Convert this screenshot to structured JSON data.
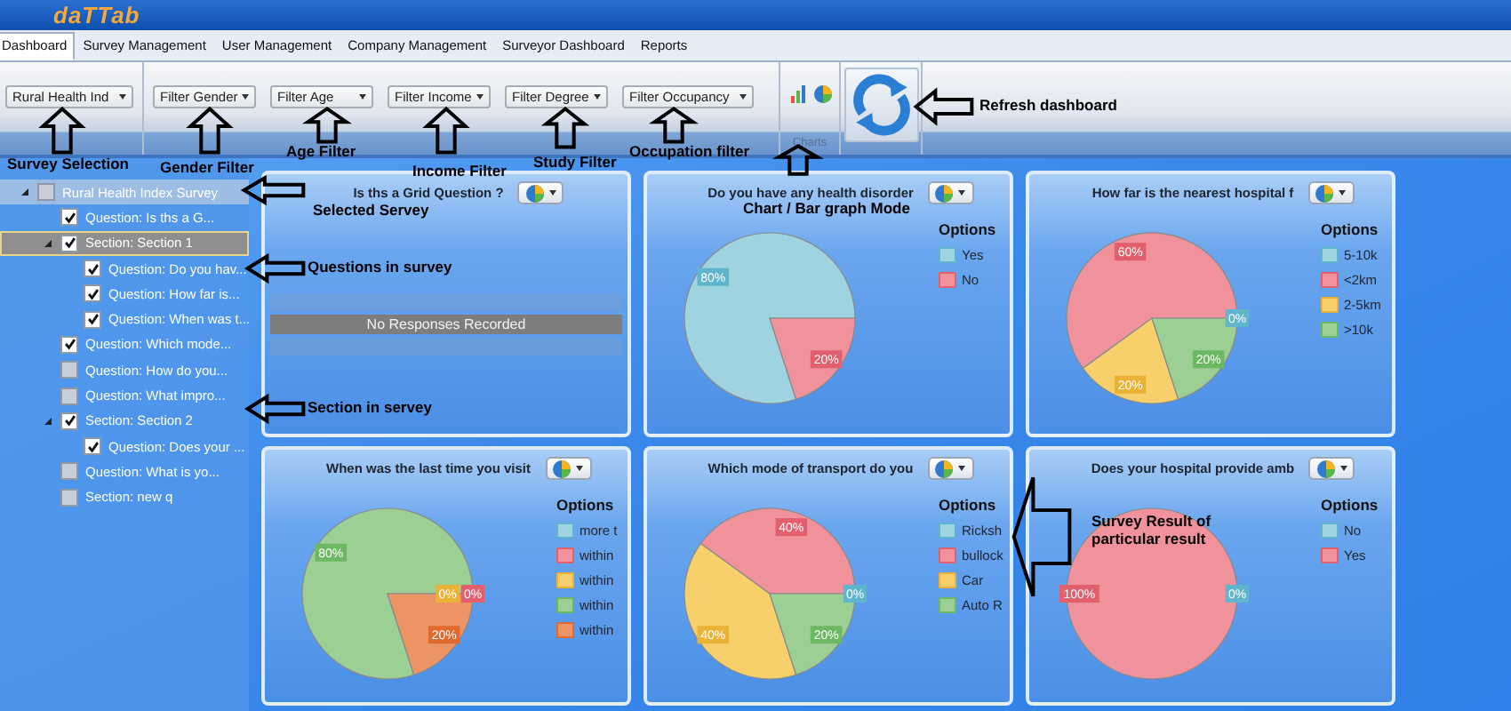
{
  "app": {
    "logo": "daTTab"
  },
  "menu": [
    {
      "label": "Dashboard",
      "selected": true
    },
    {
      "label": "Survey Management",
      "selected": false
    },
    {
      "label": "User Management",
      "selected": false
    },
    {
      "label": "Company Management",
      "selected": false
    },
    {
      "label": "Surveyor Dashboard",
      "selected": false
    },
    {
      "label": "Reports",
      "selected": false
    }
  ],
  "ribbon": {
    "survey_selector": {
      "value": "Rural Health Ind"
    },
    "filters": [
      {
        "value": "Filter Gender"
      },
      {
        "value": "Filter Age"
      },
      {
        "value": "Filter Income"
      },
      {
        "value": "Filter Degree"
      },
      {
        "value": "Filter Occupancy"
      }
    ],
    "charts_group": {
      "label": "Charts"
    }
  },
  "tree": [
    {
      "label": "Rural Health Index Survey",
      "checked": false,
      "selected": false,
      "expanded": true,
      "children": [
        {
          "label": "Question: Is ths a G...",
          "checked": true,
          "selected": false
        },
        {
          "label": "Section: Section 1",
          "checked": true,
          "selected": true,
          "expanded": true,
          "children": [
            {
              "label": "Question: Do you hav...",
              "checked": true,
              "selected": false
            },
            {
              "label": "Question: How far is...",
              "checked": true,
              "selected": false
            },
            {
              "label": "Question: When was t...",
              "checked": true,
              "selected": false
            }
          ]
        },
        {
          "label": "Question: Which mode...",
          "checked": true,
          "selected": false
        },
        {
          "label": "Question: How do you...",
          "checked": false,
          "selected": false
        },
        {
          "label": "Question: What impro...",
          "checked": false,
          "selected": false
        },
        {
          "label": "Section: Section 2",
          "checked": true,
          "selected": false,
          "expanded": true,
          "children": [
            {
              "label": "Question: Does your ...",
              "checked": true,
              "selected": false
            }
          ]
        },
        {
          "label": "Question: What is yo...",
          "checked": false,
          "selected": false
        },
        {
          "label": "Section: new q",
          "checked": false,
          "selected": false
        }
      ]
    }
  ],
  "panels": [
    {
      "kind": "empty",
      "title": "Is ths a Grid Question ?",
      "message": "No Responses Recorded"
    },
    {
      "kind": "pie",
      "title": "Do you have any health disorder",
      "chart_data": {
        "type": "pie",
        "categories": [
          "Yes",
          "No"
        ],
        "series": [
          {
            "name": "Options",
            "values": [
              80,
              20
            ]
          }
        ],
        "value_labels": [
          "80%",
          "20%"
        ]
      }
    },
    {
      "kind": "pie",
      "title": "How far is the nearest hospital f",
      "chart_data": {
        "type": "pie",
        "categories": [
          "5-10k",
          "<2km",
          "2-5km",
          ">10k"
        ],
        "series": [
          {
            "name": "Options",
            "values": [
              0,
              60,
              20,
              20
            ]
          }
        ],
        "value_labels": [
          "0%",
          "60%",
          "20%",
          "20%"
        ]
      }
    },
    {
      "kind": "pie",
      "title": "When was the last time you visit",
      "chart_data": {
        "type": "pie",
        "categories": [
          "more t",
          "within",
          "within",
          "within",
          "within"
        ],
        "series": [
          {
            "name": "Options",
            "values": [
              null,
              0,
              0,
              80,
              20
            ]
          }
        ],
        "value_labels": [
          null,
          "0%",
          "0%",
          "80%",
          "20%"
        ]
      }
    },
    {
      "kind": "pie",
      "title": "Which mode of transport do you",
      "chart_data": {
        "type": "pie",
        "categories": [
          "Ricksh",
          "bullock",
          "Car",
          "Auto R"
        ],
        "series": [
          {
            "name": "Options",
            "values": [
              0,
              40,
              40,
              20
            ]
          }
        ],
        "value_labels": [
          "0%",
          "40%",
          "40%",
          "20%"
        ]
      }
    },
    {
      "kind": "pie",
      "title": "Does your hospital provide amb",
      "chart_data": {
        "type": "pie",
        "categories": [
          "No",
          "Yes"
        ],
        "series": [
          {
            "name": "Options",
            "values": [
              0,
              100
            ]
          }
        ],
        "value_labels": [
          "0%",
          "100%"
        ]
      }
    }
  ],
  "annotations": [
    {
      "kind": "arrow-up",
      "text": "Survey Selection"
    },
    {
      "kind": "arrow-up",
      "text": "Gender Filter"
    },
    {
      "kind": "arrow-up",
      "text": "Age Filter"
    },
    {
      "kind": "arrow-up",
      "text": "Income Filter"
    },
    {
      "kind": "arrow-up",
      "text": "Study Filter"
    },
    {
      "kind": "arrow-up",
      "text": "Occupation filter"
    },
    {
      "kind": "arrow-up",
      "text": "Chart / Bar graph Mode"
    },
    {
      "kind": "arrow-left",
      "text": "Refresh dashboard"
    },
    {
      "kind": "arrow-left",
      "text": "Selected Servey"
    },
    {
      "kind": "arrow-left",
      "text": "Questions in survey"
    },
    {
      "kind": "arrow-left",
      "text": "Section in servey"
    },
    {
      "kind": "arrow-left",
      "text": "Survey Result of particular result"
    }
  ]
}
